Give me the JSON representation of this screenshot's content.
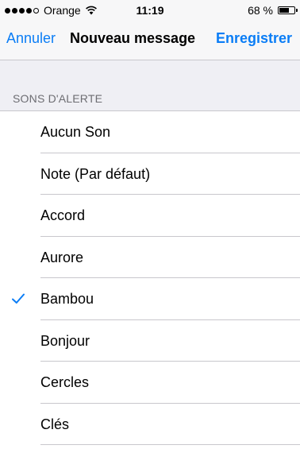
{
  "status_bar": {
    "carrier": "Orange",
    "time": "11:19",
    "battery": "68 %",
    "battery_level": 0.68,
    "signal_bars": 4,
    "signal_total": 5
  },
  "nav": {
    "cancel_label": "Annuler",
    "title": "Nouveau message",
    "save_label": "Enregistrer"
  },
  "section": {
    "header": "SONS D'ALERTE"
  },
  "sounds": [
    {
      "label": "Aucun Son",
      "selected": false
    },
    {
      "label": "Note (Par défaut)",
      "selected": false
    },
    {
      "label": "Accord",
      "selected": false
    },
    {
      "label": "Aurore",
      "selected": false
    },
    {
      "label": "Bambou",
      "selected": true
    },
    {
      "label": "Bonjour",
      "selected": false
    },
    {
      "label": "Cercles",
      "selected": false
    },
    {
      "label": "Clés",
      "selected": false
    }
  ],
  "colors": {
    "accent": "#0a7df6",
    "background": "#efeff4",
    "separator": "#c8c7cc"
  }
}
